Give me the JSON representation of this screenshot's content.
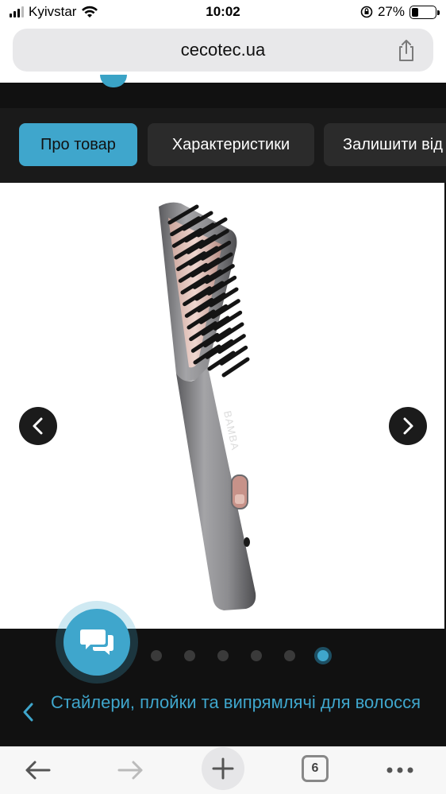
{
  "status_bar": {
    "carrier": "Kyivstar",
    "time": "10:02",
    "battery": "27%",
    "battery_level": 0.27,
    "icons": [
      "signal-icon",
      "wifi-icon",
      "orientation-lock-icon",
      "battery-icon"
    ]
  },
  "browser": {
    "url": "cecotec.ua",
    "share_icon": "share-icon"
  },
  "tabs": [
    {
      "label": "Про товар",
      "active": true
    },
    {
      "label": "Характеристики",
      "active": false
    },
    {
      "label": "Залишити від",
      "active": false
    }
  ],
  "gallery": {
    "image_alt": "hair-straightening-brush",
    "brand_text": "BAMBA",
    "prev_icon": "chevron-left-icon",
    "next_icon": "chevron-right-icon",
    "dots_total": 6,
    "dots_active": 6
  },
  "chat_button": {
    "icon": "chat-bubbles-icon"
  },
  "breadcrumb": {
    "label": "Стайлери, плойки та випрямлячі для волосся",
    "icon": "chevron-left-icon"
  },
  "toolbar": {
    "back_icon": "arrow-left-icon",
    "forward_icon": "arrow-right-icon",
    "new_tab_icon": "plus-icon",
    "tabs_count": "6",
    "more_icon": "more-dots-icon"
  },
  "colors": {
    "accent": "#3fa6cc",
    "dark_bg": "#111111",
    "tab_bg": "#2b2b2b"
  }
}
